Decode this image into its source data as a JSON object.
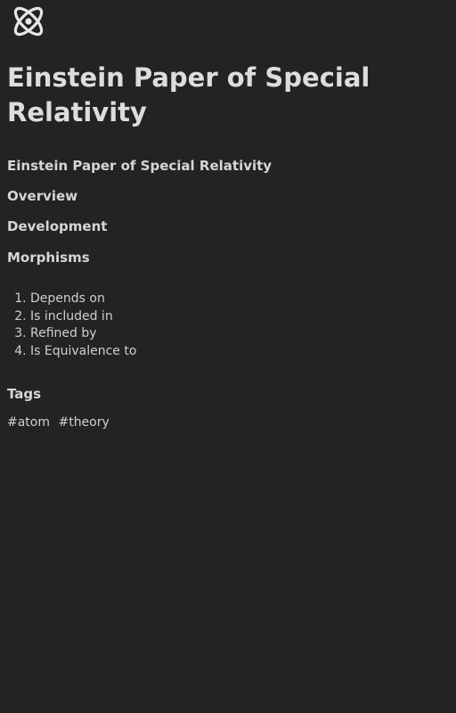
{
  "page": {
    "logo_icon": "atom-icon",
    "title": "Einstein Paper of Special Relativity",
    "subtitle": "Einstein Paper of Special Relativity"
  },
  "sections": {
    "overview": "Overview",
    "development": "Development",
    "morphisms": "Morphisms",
    "tags": "Tags"
  },
  "morphisms": [
    "Depends on",
    "Is included in",
    "Refined by",
    "Is Equivalence to"
  ],
  "tags": [
    "#atom",
    "#theory"
  ],
  "colors": {
    "background": "#232323",
    "text": "#d9d9d9"
  }
}
